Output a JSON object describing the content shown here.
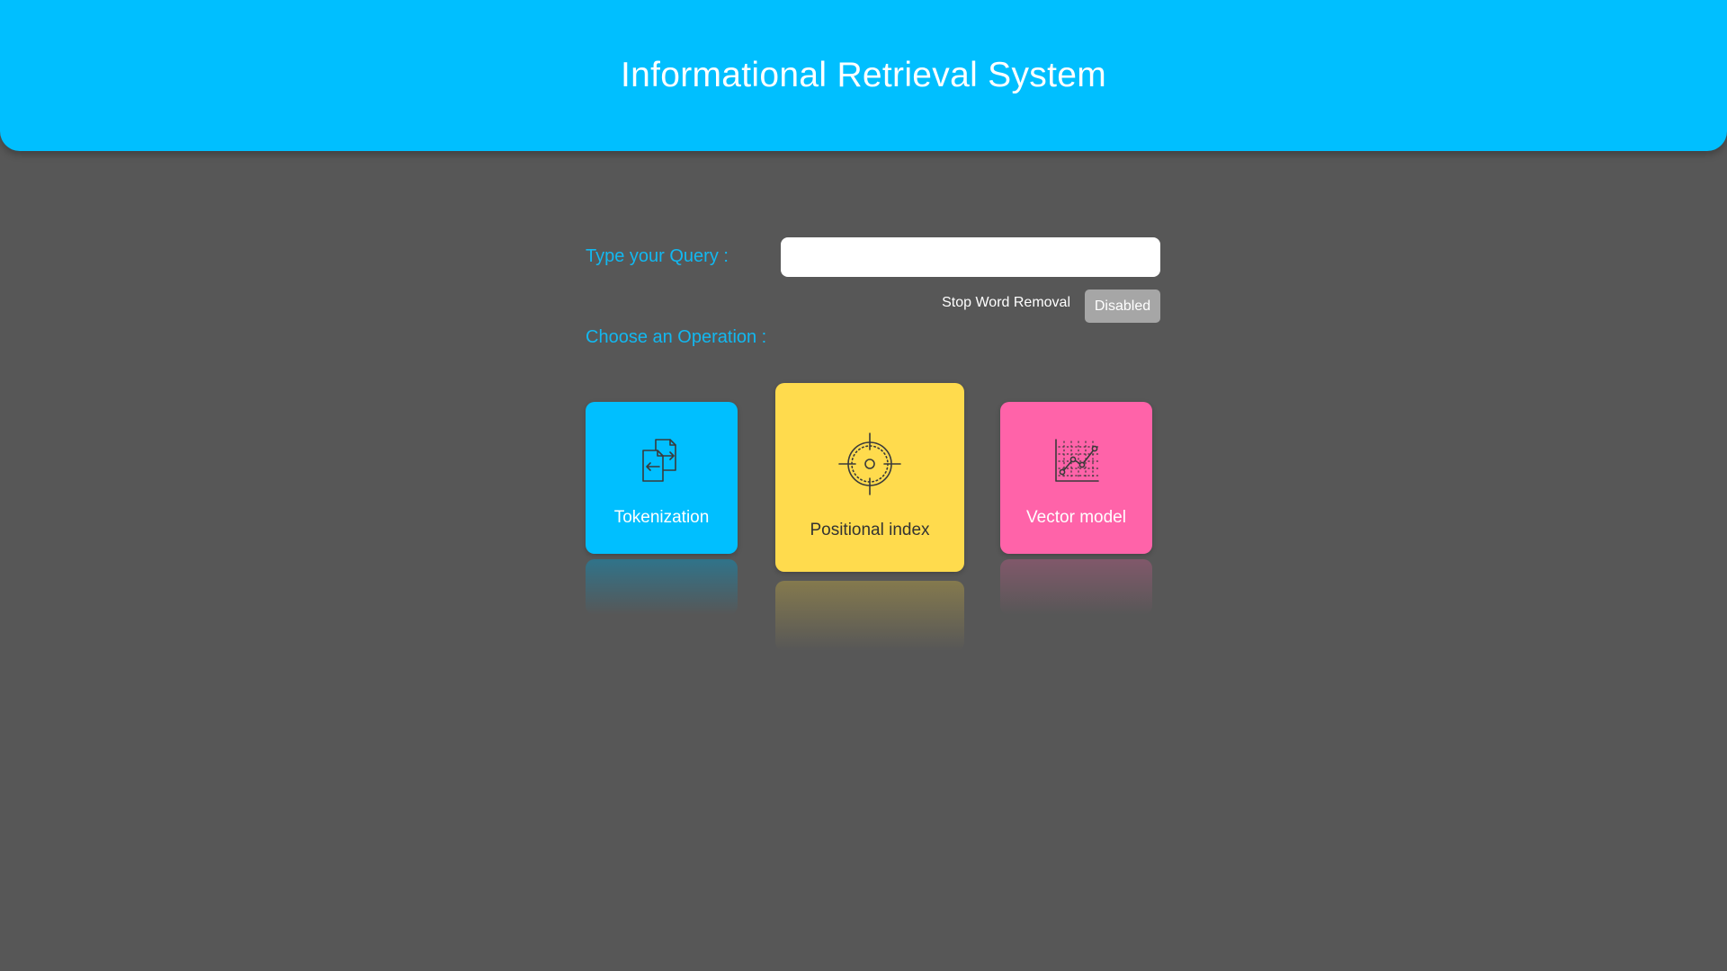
{
  "header": {
    "title": "Informational Retrieval System"
  },
  "query": {
    "label": "Type your Query :",
    "value": "",
    "placeholder": ""
  },
  "stop_word": {
    "label": "Stop Word Removal",
    "toggle_label": "Disabled"
  },
  "operations": {
    "label": "Choose an Operation :",
    "items": [
      {
        "label": "Tokenization",
        "icon": "swap-documents-icon",
        "color": "#00bfff"
      },
      {
        "label": "Positional index",
        "icon": "crosshair-icon",
        "color": "#ffdb4d"
      },
      {
        "label": "Vector model",
        "icon": "line-chart-icon",
        "color": "#ff63a9"
      }
    ]
  },
  "colors": {
    "accent": "#00bfff",
    "background": "#575757",
    "label_text": "#12b8f0",
    "toggle_disabled": "#a6a6a6"
  }
}
